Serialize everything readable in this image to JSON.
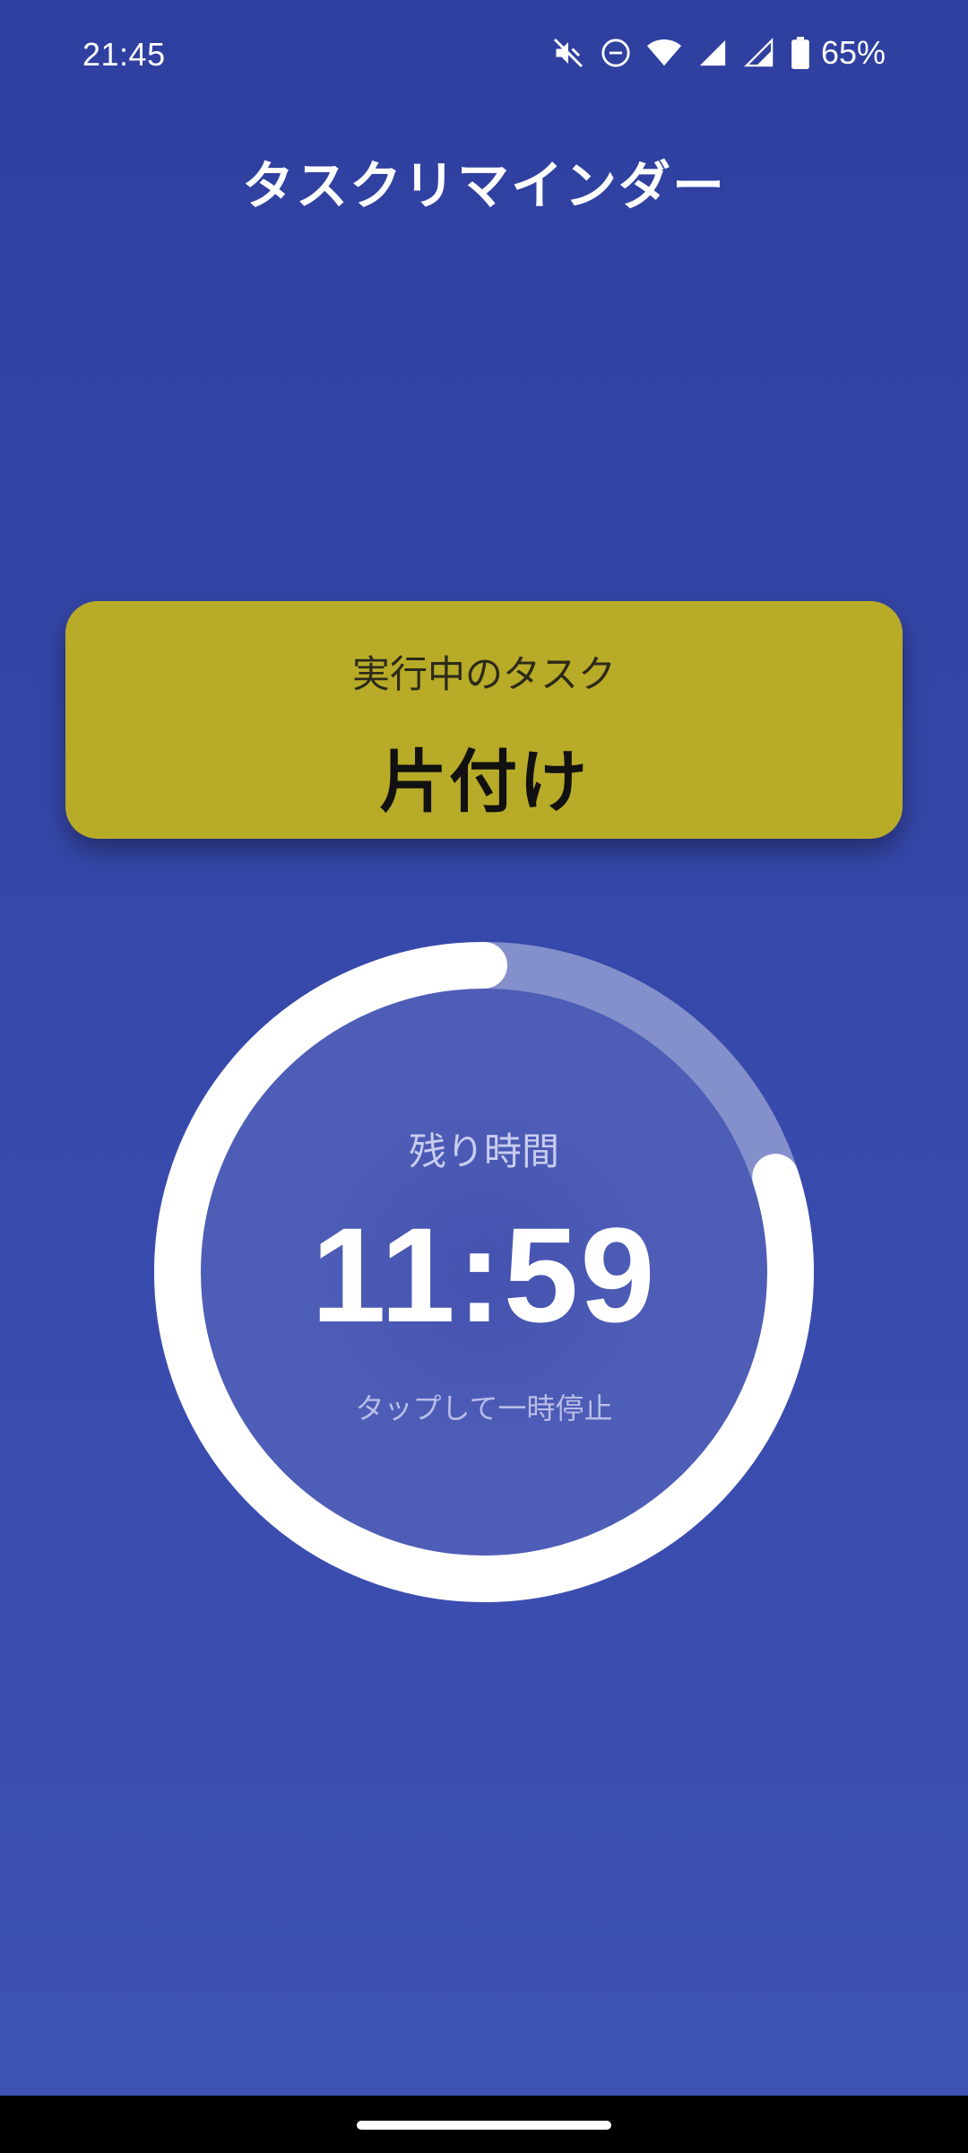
{
  "status_bar": {
    "time": "21:45",
    "battery_percent": "65%",
    "icons": [
      "mute-icon",
      "do-not-disturb-icon",
      "wifi-icon",
      "signal-icon",
      "signal-icon-2",
      "battery-icon"
    ]
  },
  "app": {
    "title": "タスクリマインダー"
  },
  "task_card": {
    "label": "実行中のタスク",
    "task_name": "片付け",
    "color": "#b8ab28"
  },
  "timer": {
    "label": "残り時間",
    "remaining": "11:59",
    "hint": "タップして一時停止",
    "progress_remaining_fraction": 0.8,
    "ring_color": "#ffffff",
    "track_color": "#8390cc"
  },
  "colors": {
    "background_top": "#2f3f9f",
    "background_bottom": "#3f52b5"
  }
}
